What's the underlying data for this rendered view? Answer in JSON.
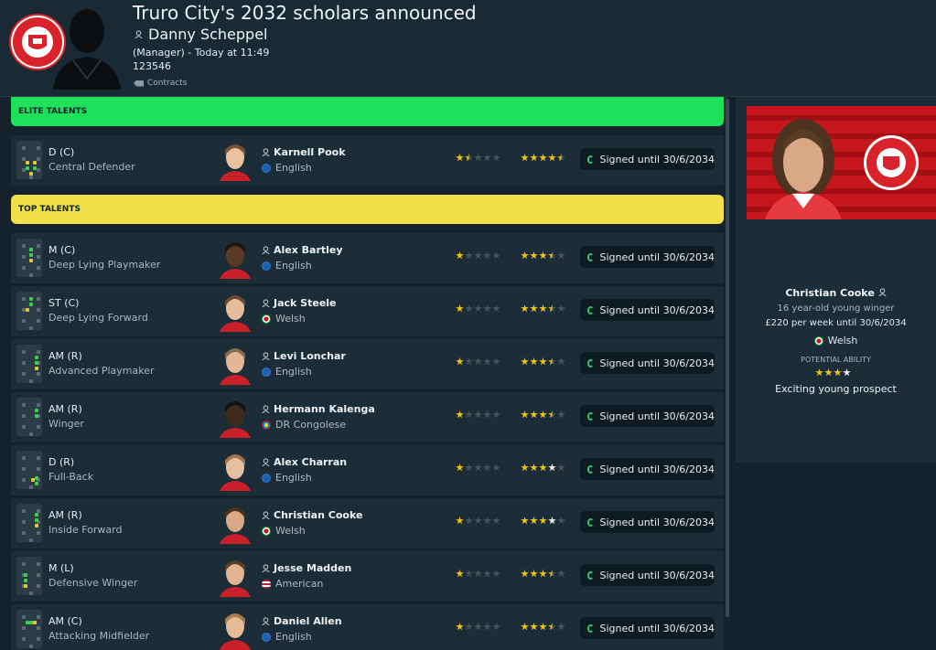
{
  "header": {
    "title": "Truro City's 2032 scholars announced",
    "author": "Danny Scheppel",
    "role_time": "(Manager) - Today at 11:49",
    "id_line": "123546",
    "tag": "Contracts"
  },
  "crest_text": "TRURO CITY FOOTBALL CLUB",
  "sections": {
    "elite": {
      "label": "ELITE TALENTS",
      "color": "#1ee05b"
    },
    "top": {
      "label": "TOP TALENTS",
      "color": "#f0e04a"
    }
  },
  "players": [
    {
      "position": "D (C)",
      "role": "Central Defender",
      "name": "Karnell Pook",
      "nationality": "English",
      "ca_stars": 1.5,
      "pa_stars": 4.5,
      "contract": "Signed until 30/6/2034"
    },
    {
      "position": "M (C)",
      "role": "Deep Lying Playmaker",
      "name": "Alex Bartley",
      "nationality": "English",
      "ca_stars": 1,
      "pa_stars": 3.5,
      "contract": "Signed until 30/6/2034"
    },
    {
      "position": "ST (C)",
      "role": "Deep Lying Forward",
      "name": "Jack Steele",
      "nationality": "Welsh",
      "ca_stars": 1,
      "pa_stars": 3.5,
      "contract": "Signed until 30/6/2034"
    },
    {
      "position": "AM (R)",
      "role": "Advanced Playmaker",
      "name": "Levi Lonchar",
      "nationality": "English",
      "ca_stars": 1,
      "pa_stars": 3.5,
      "contract": "Signed until 30/6/2034"
    },
    {
      "position": "AM (R)",
      "role": "Winger",
      "name": "Hermann Kalenga",
      "nationality": "DR Congolese",
      "ca_stars": 1,
      "pa_stars": 3.5,
      "contract": "Signed until 30/6/2034"
    },
    {
      "position": "D (R)",
      "role": "Full-Back",
      "name": "Alex Charran",
      "nationality": "English",
      "ca_stars": 1,
      "pa_stars": 4,
      "contract": "Signed until 30/6/2034"
    },
    {
      "position": "AM (R)",
      "role": "Inside Forward",
      "name": "Christian Cooke",
      "nationality": "Welsh",
      "ca_stars": 1,
      "pa_stars": 4,
      "contract": "Signed until 30/6/2034"
    },
    {
      "position": "M (L)",
      "role": "Defensive Winger",
      "name": "Jesse Madden",
      "nationality": "American",
      "ca_stars": 1,
      "pa_stars": 3.5,
      "contract": "Signed until 30/6/2034"
    },
    {
      "position": "AM (C)",
      "role": "Attacking Midfielder",
      "name": "Daniel Allen",
      "nationality": "English",
      "ca_stars": 1,
      "pa_stars": 3.5,
      "contract": "Signed until 30/6/2034"
    }
  ],
  "panel": {
    "name": "Christian Cooke",
    "description": "16 year-old young winger",
    "wage": "£220 per week until 30/6/2034",
    "nationality": "Welsh",
    "pa_label": "POTENTIAL ABILITY",
    "pa_stars": 4,
    "verdict": "Exciting young prospect"
  },
  "colors": {
    "bg": "#15222c",
    "row": "#1c2d38",
    "star": "#f1c515",
    "renew": "#38c66a"
  }
}
